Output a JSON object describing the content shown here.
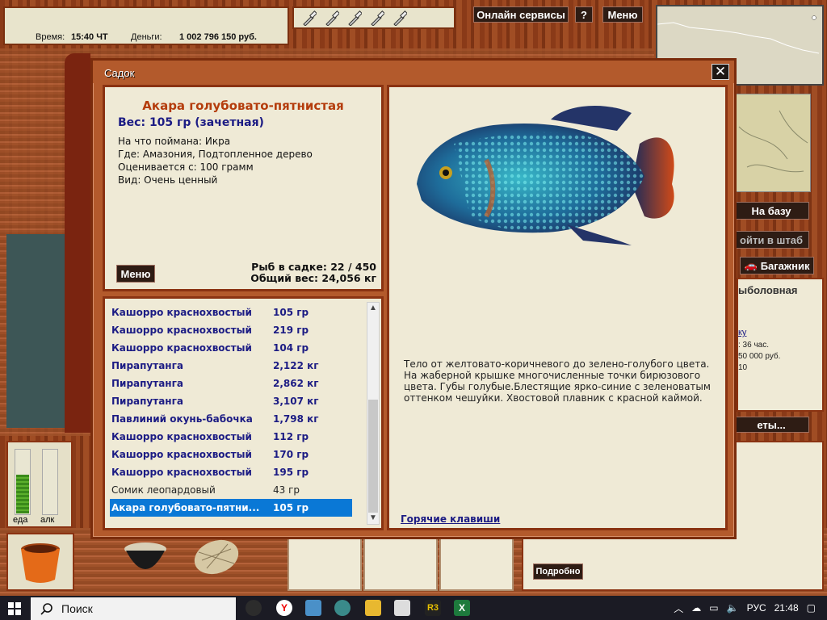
{
  "status": {
    "time_label": "Время:",
    "time_value": "15:40 ЧТ",
    "money_label": "Деньги:",
    "money_value": "1 002 796 150 руб."
  },
  "topbar": {
    "online_label": "Онлайн сервисы",
    "help_label": "?",
    "menu_label": "Меню",
    "bottle_count": 5
  },
  "right": {
    "base_label": "На базу",
    "hq_label": "ойти в штаб",
    "trunk_label": "Багажник",
    "panel_title": "ыболовная",
    "panel_link": "ку",
    "panel_line1": ": 36 час.",
    "panel_line2": "50 000 руб.",
    "panel_line3": "10",
    "tickets_label": "еты...",
    "details_label": "Подробно"
  },
  "meters": {
    "food_label": "еда",
    "alc_label": "алк",
    "food_level": 0.6,
    "alc_level": 0.0
  },
  "dialog": {
    "title": "Садок",
    "close_label": "✕",
    "fish_name": "Акара голубовато-пятнистая",
    "weight": "Вес: 105 гр (зачетная)",
    "bait": "На что поймана: Икра",
    "place": "Где: Амазония, Подтопленное дерево",
    "min_weight": "Оценивается с: 100 грамм",
    "kind": "Вид: Очень ценный",
    "menu_label": "Меню",
    "count": "Рыб в садке: 22 / 450",
    "total_weight": "Общий вес: 24,056 кг",
    "description": "Тело от желтовато-коричневого до зелено-голубого цвета. На жаберной крышке многочисленные точки бирюзового цвета. Губы голубые.Блестящие ярко-синие с зеленоватым оттенком чешуйки. Хвостовой плавник с красной каймой.",
    "hotkeys": "Горячие клавиши",
    "fish_list": [
      {
        "name": "Кашорро краснохвостый",
        "weight": "105 гр",
        "style": "bold"
      },
      {
        "name": "Кашорро краснохвостый",
        "weight": "219 гр",
        "style": "bold"
      },
      {
        "name": "Кашорро краснохвостый",
        "weight": "104 гр",
        "style": "bold"
      },
      {
        "name": "Пирапутанга",
        "weight": "2,122 кг",
        "style": "bold"
      },
      {
        "name": "Пирапутанга",
        "weight": "2,862 кг",
        "style": "bold"
      },
      {
        "name": "Пирапутанга",
        "weight": "3,107 кг",
        "style": "bold"
      },
      {
        "name": "Павлиний окунь-бабочка",
        "weight": "1,798 кг",
        "style": "bold"
      },
      {
        "name": "Кашорро краснохвостый",
        "weight": "112 гр",
        "style": "bold"
      },
      {
        "name": "Кашорро краснохвостый",
        "weight": "170 гр",
        "style": "bold"
      },
      {
        "name": "Кашорро краснохвостый",
        "weight": "195 гр",
        "style": "bold"
      },
      {
        "name": "Сомик леопардовый",
        "weight": "43 гр",
        "style": "plain"
      },
      {
        "name": "Акара голубовато-пятнистая",
        "weight": "105 гр",
        "style": "selected"
      }
    ]
  },
  "taskbar": {
    "search_placeholder": "Поиск",
    "language": "РУС",
    "clock": "21:48"
  },
  "colors": {
    "wood": "#b35a2c",
    "panel": "#efead6",
    "fish_name": "#b43c0c",
    "list_text": "#1c1c84",
    "selection": "#0a78d6"
  }
}
